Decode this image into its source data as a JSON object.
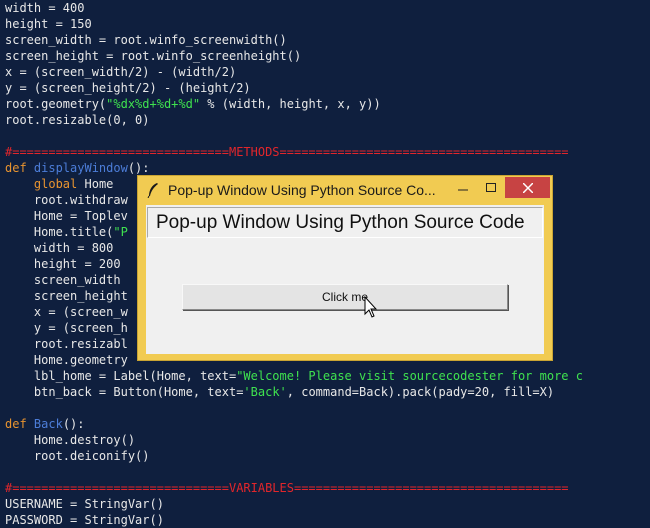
{
  "editor": {
    "lines": [
      [
        {
          "t": "width = 400"
        }
      ],
      [
        {
          "t": "height = 150"
        }
      ],
      [
        {
          "t": "screen_width = root.winfo_screenwidth()"
        }
      ],
      [
        {
          "t": "screen_height = root.winfo_screenheight()"
        }
      ],
      [
        {
          "t": "x = (screen_width/2) - (width/2)"
        }
      ],
      [
        {
          "t": "y = (screen_height/2) - (height/2)"
        }
      ],
      [
        {
          "t": "root.geometry("
        },
        {
          "t": "\"%dx%d+%d+%d\"",
          "c": "str"
        },
        {
          "t": " % (width, height, x, y))"
        }
      ],
      [
        {
          "t": "root.resizable(0, 0)"
        }
      ],
      [],
      [
        {
          "t": "#==============================METHODS========================================",
          "c": "cm"
        }
      ],
      [
        {
          "t": "def ",
          "c": "kw"
        },
        {
          "t": "displayWindow",
          "c": "fn"
        },
        {
          "t": "():"
        }
      ],
      [
        {
          "t": "    "
        },
        {
          "t": "global",
          "c": "kw"
        },
        {
          "t": " Home"
        }
      ],
      [
        {
          "t": "    root.withdraw"
        }
      ],
      [
        {
          "t": "    Home = Toplev"
        }
      ],
      [
        {
          "t": "    Home.title("
        },
        {
          "t": "\"P",
          "c": "str"
        }
      ],
      [
        {
          "t": "    width = 800"
        }
      ],
      [
        {
          "t": "    height = 200"
        }
      ],
      [
        {
          "t": "    screen_width"
        }
      ],
      [
        {
          "t": "    screen_height"
        }
      ],
      [
        {
          "t": "    x = (screen_w"
        }
      ],
      [
        {
          "t": "    y = (screen_h"
        }
      ],
      [
        {
          "t": "    root.resizabl"
        }
      ],
      [
        {
          "t": "    Home.geometry"
        }
      ],
      [
        {
          "t": "    lbl_home = Label(Home, text="
        },
        {
          "t": "\"Welcome! Please visit sourcecodester for more c",
          "c": "str"
        }
      ],
      [
        {
          "t": "    btn_back = Button(Home, text="
        },
        {
          "t": "'Back'",
          "c": "str"
        },
        {
          "t": ", command=Back).pack(pady=20, fill=X)"
        }
      ],
      [],
      [
        {
          "t": "def ",
          "c": "kw"
        },
        {
          "t": "Back",
          "c": "fn"
        },
        {
          "t": "():"
        }
      ],
      [
        {
          "t": "    Home.destroy()"
        }
      ],
      [
        {
          "t": "    root.deiconify()"
        }
      ],
      [],
      [
        {
          "t": "#==============================VARIABLES======================================",
          "c": "cm"
        }
      ],
      [
        {
          "t": "USERNAME = StringVar()"
        }
      ],
      [
        {
          "t": "PASSWORD = StringVar()"
        }
      ]
    ]
  },
  "popup": {
    "title": "Pop-up Window Using Python Source Co...",
    "heading": "Pop-up Window Using Python Source Code",
    "button_label": "Click me",
    "icons": {
      "app": "feather-icon",
      "minimize": "minimize-icon",
      "maximize": "maximize-icon",
      "close": "close-icon",
      "cursor": "mouse-cursor-icon"
    },
    "colors": {
      "frame": "#f1cb52",
      "close_button": "#c74343",
      "client": "#f0f0f0"
    }
  },
  "colors": {
    "background": "#0f1f3e",
    "text": "#e8e8e8",
    "keyword": "#e89430",
    "function": "#4c7dd8",
    "string": "#3fe24f",
    "comment": "#e2262b"
  }
}
